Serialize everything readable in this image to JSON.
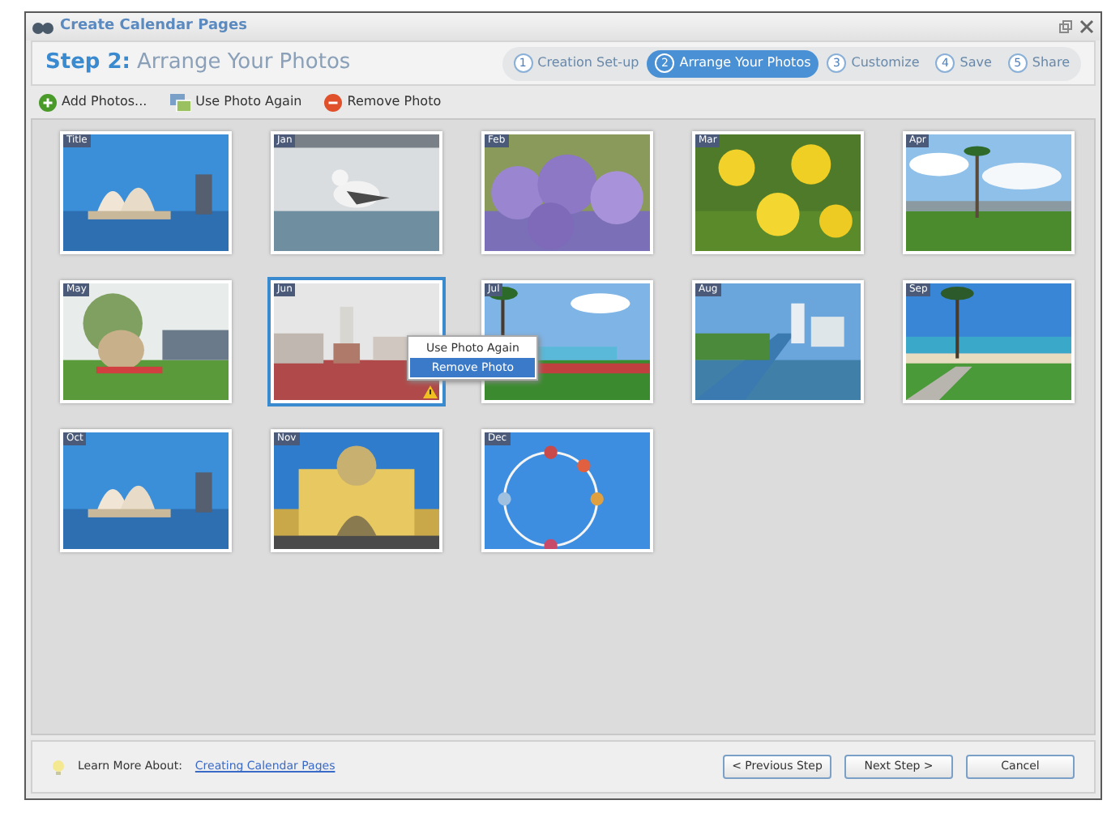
{
  "window": {
    "title": "Create Calendar Pages"
  },
  "step_title": {
    "label": "Step 2:",
    "text": "Arrange Your Photos"
  },
  "steps": [
    {
      "number": "1",
      "label": "Creation Set-up",
      "selected": false
    },
    {
      "number": "2",
      "label": "Arrange Your Photos",
      "selected": true
    },
    {
      "number": "3",
      "label": "Customize",
      "selected": false
    },
    {
      "number": "4",
      "label": "Save",
      "selected": false
    },
    {
      "number": "5",
      "label": "Share",
      "selected": false
    }
  ],
  "toolbar": [
    {
      "kind": "add",
      "label": "Add Photos..."
    },
    {
      "kind": "reuse",
      "label": "Use Photo Again"
    },
    {
      "kind": "remove",
      "label": "Remove Photo"
    }
  ],
  "photos": [
    {
      "month": "Title",
      "selected": false,
      "warning": false
    },
    {
      "month": "Jan",
      "selected": false,
      "warning": false
    },
    {
      "month": "Feb",
      "selected": false,
      "warning": false
    },
    {
      "month": "Mar",
      "selected": false,
      "warning": false
    },
    {
      "month": "Apr",
      "selected": false,
      "warning": false
    },
    {
      "month": "May",
      "selected": false,
      "warning": false
    },
    {
      "month": "Jun",
      "selected": true,
      "warning": true
    },
    {
      "month": "Jul",
      "selected": false,
      "warning": false
    },
    {
      "month": "Aug",
      "selected": false,
      "warning": false
    },
    {
      "month": "Sep",
      "selected": false,
      "warning": false
    },
    {
      "month": "Oct",
      "selected": false,
      "warning": false
    },
    {
      "month": "Nov",
      "selected": false,
      "warning": false
    },
    {
      "month": "Dec",
      "selected": false,
      "warning": false
    }
  ],
  "context_menu": [
    {
      "label": "Use Photo Again",
      "selected": false
    },
    {
      "label": "Remove Photo",
      "selected": true
    }
  ],
  "footer": {
    "learn_label": "Learn More About:",
    "link": "Creating Calendar Pages",
    "buttons": [
      "< Previous Step",
      "Next Step >",
      "Cancel"
    ]
  }
}
